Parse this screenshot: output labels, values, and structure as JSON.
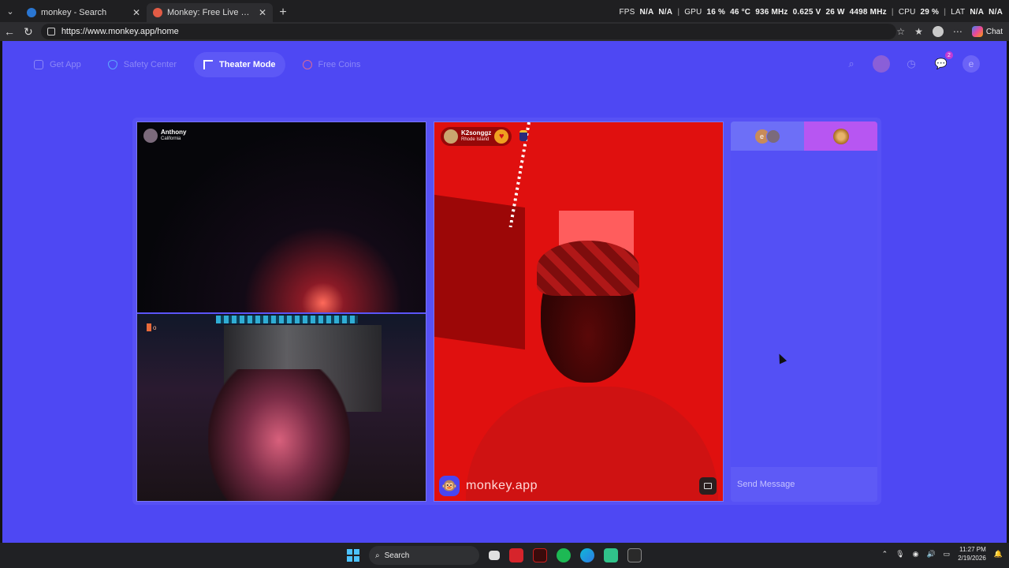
{
  "browser": {
    "tabs": [
      {
        "title": "monkey - Search",
        "favicon_color": "#2a76d2"
      },
      {
        "title": "Monkey: Free Live Video Chat",
        "favicon_color": "#e25b45"
      }
    ],
    "url": "https://www.monkey.app/home",
    "chat_label": "Chat",
    "perf": {
      "fps_label": "FPS",
      "fps_value": "N/A",
      "fps_value2": "N/A",
      "gpu_label": "GPU",
      "gpu_usage": "16 %",
      "gpu_temp": "46 °C",
      "gpu_clock": "936 MHz",
      "gpu_volt": "0.625 V",
      "gpu_power": "26 W",
      "gpu_mem": "4498 MHz",
      "cpu_label": "CPU",
      "cpu_usage": "29 %",
      "lat_label": "LAT",
      "lat_value": "N/A",
      "lat_value2": "N/A"
    }
  },
  "topnav": {
    "get_app": "Get App",
    "safety_center": "Safety Center",
    "theater_mode": "Theater Mode",
    "free_coins": "Free Coins"
  },
  "topright": {
    "notification_count": "2",
    "user_initial": "e"
  },
  "left_video": {
    "name": "Anthony",
    "location": "California",
    "self_tag": "o"
  },
  "center_video": {
    "name": "K2songgz",
    "location": "Rhode Island",
    "watermark": "monkey.app"
  },
  "chat": {
    "tab1_initial": "e",
    "placeholder": "Send Message"
  },
  "taskbar": {
    "search_label": "Search",
    "time": "11:27 PM",
    "date": "2/19/2026"
  },
  "colors": {
    "page_bg": "#4e48f3",
    "accent_tab": "#b756f2",
    "video_red": "#e0100f"
  }
}
